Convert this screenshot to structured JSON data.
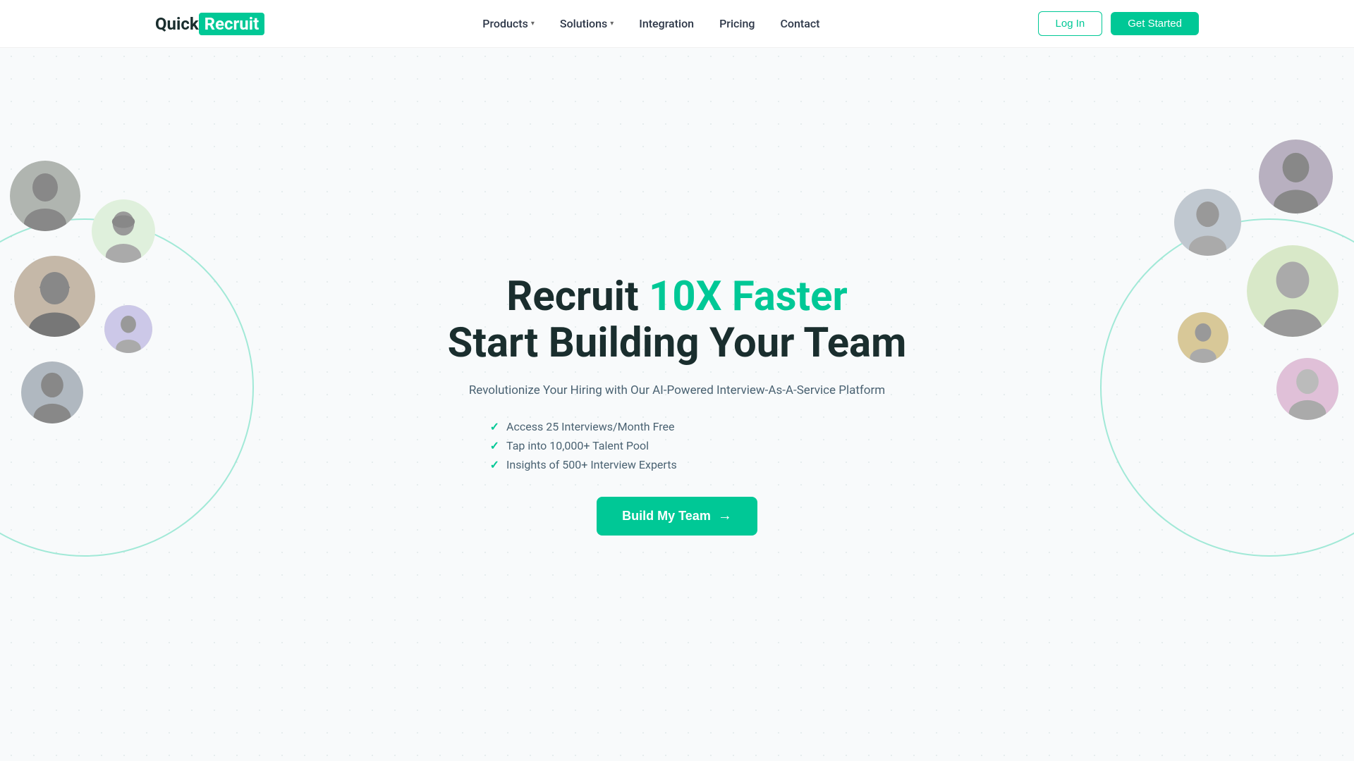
{
  "nav": {
    "logo_quick": "Quick",
    "logo_recruit": "Recruit",
    "links": [
      {
        "label": "Products",
        "has_dropdown": true
      },
      {
        "label": "Solutions",
        "has_dropdown": true
      },
      {
        "label": "Integration",
        "has_dropdown": false
      },
      {
        "label": "Pricing",
        "has_dropdown": false
      },
      {
        "label": "Contact",
        "has_dropdown": false
      }
    ],
    "login_label": "Log In",
    "get_started_label": "Get Started"
  },
  "hero": {
    "title_part1": "Recruit ",
    "title_accent": "10X Faster",
    "title_line2": "Start Building Your Team",
    "subtitle": "Revolutionize Your Hiring with Our AI-Powered Interview-As-A-Service Platform",
    "features": [
      "Access 25 Interviews/Month Free",
      "Tap into 10,000+ Talent Pool",
      "Insights of 500+ Interview Experts"
    ],
    "cta_label": "Build My Team",
    "cta_arrow": "→"
  },
  "avatars": {
    "left": [
      {
        "id": "av-l1",
        "emoji": "👤"
      },
      {
        "id": "av-l2",
        "emoji": "🧑"
      },
      {
        "id": "av-l3",
        "emoji": "👩"
      },
      {
        "id": "av-l4",
        "emoji": "👤"
      },
      {
        "id": "av-l5",
        "emoji": "👨"
      }
    ],
    "right": [
      {
        "id": "av-r1",
        "emoji": "👩"
      },
      {
        "id": "av-r2",
        "emoji": "👨"
      },
      {
        "id": "av-r3",
        "emoji": "👱"
      },
      {
        "id": "av-r4",
        "emoji": "🧔"
      },
      {
        "id": "av-r5",
        "emoji": "👤"
      }
    ]
  },
  "colors": {
    "accent": "#00c896",
    "text_dark": "#1a2e2e",
    "text_muted": "#4a6272"
  }
}
